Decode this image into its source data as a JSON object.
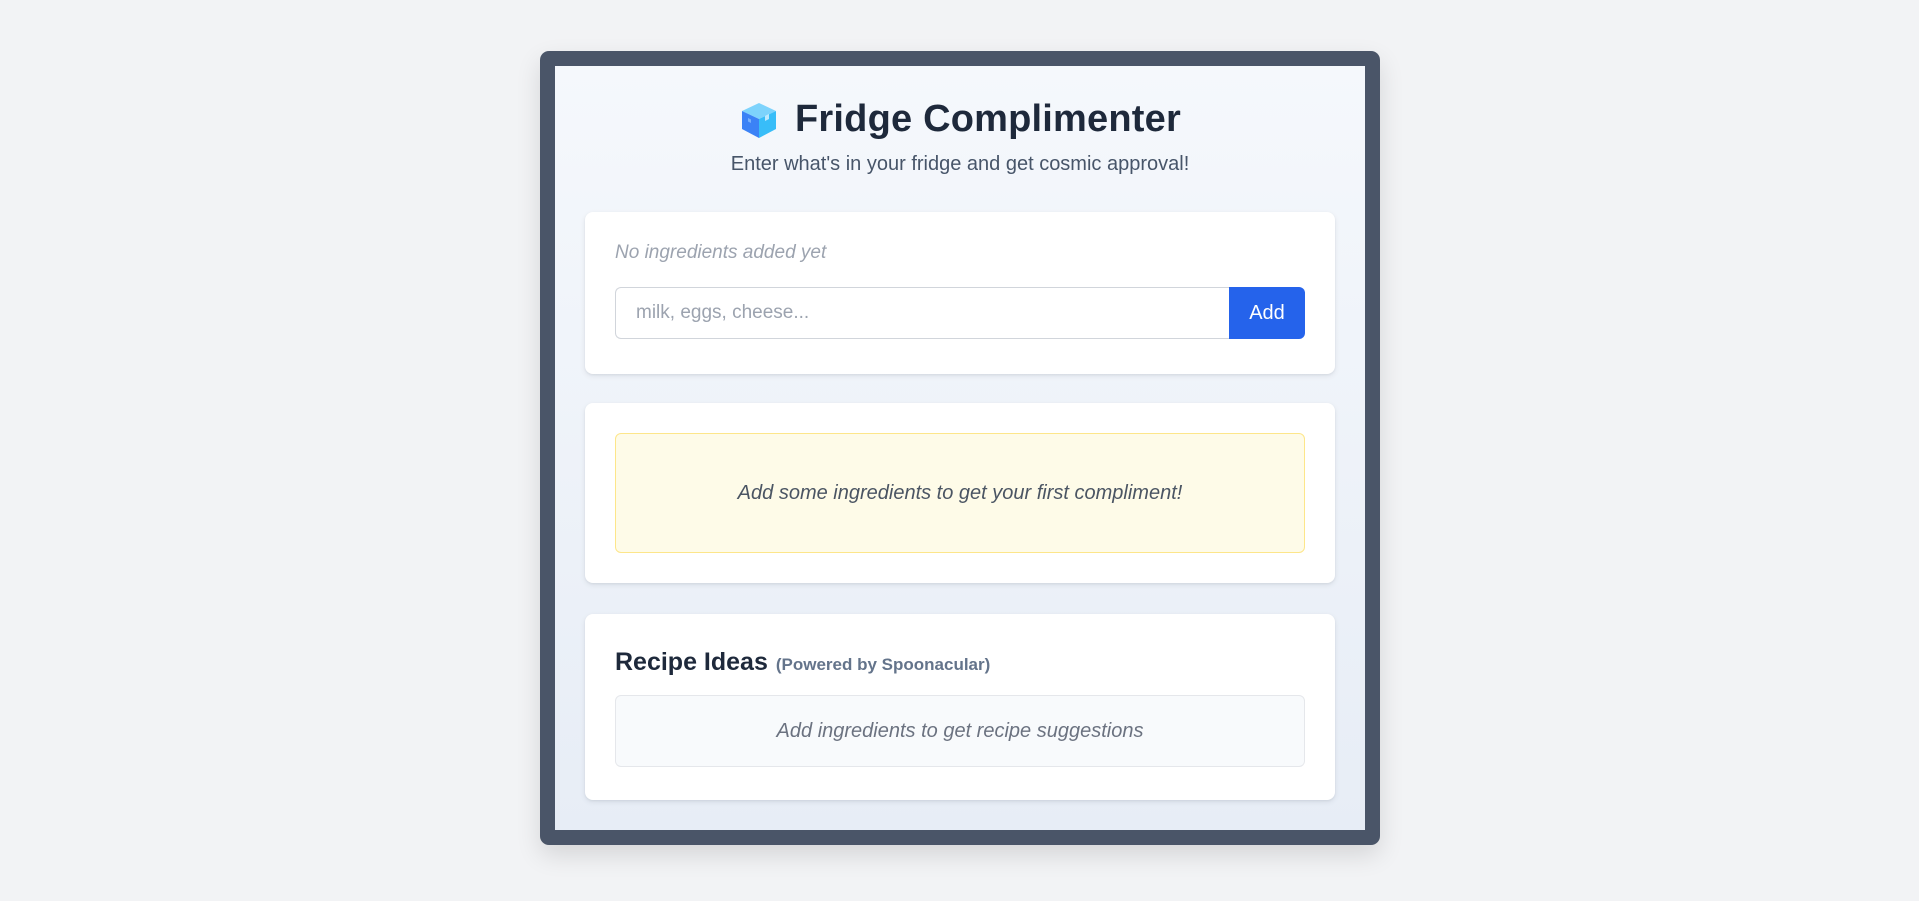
{
  "app": {
    "title": "Fridge Complimenter",
    "subtitle": "Enter what's in your fridge and get cosmic approval!",
    "icon": "ice-cube-icon"
  },
  "ingredients": {
    "empty_text": "No ingredients added yet",
    "input_placeholder": "milk, eggs, cheese...",
    "input_value": "",
    "add_label": "Add"
  },
  "compliment": {
    "placeholder_text": "Add some ingredients to get your first compliment!"
  },
  "recipes": {
    "heading": "Recipe Ideas",
    "powered_by": "(Powered by Spoonacular)",
    "empty_text": "Add ingredients to get recipe suggestions"
  },
  "colors": {
    "page_bg": "#f2f3f5",
    "frame": "#4a5568",
    "accent": "#2563eb",
    "compliment_bg": "#fefbe8",
    "compliment_border": "#fde68a"
  }
}
